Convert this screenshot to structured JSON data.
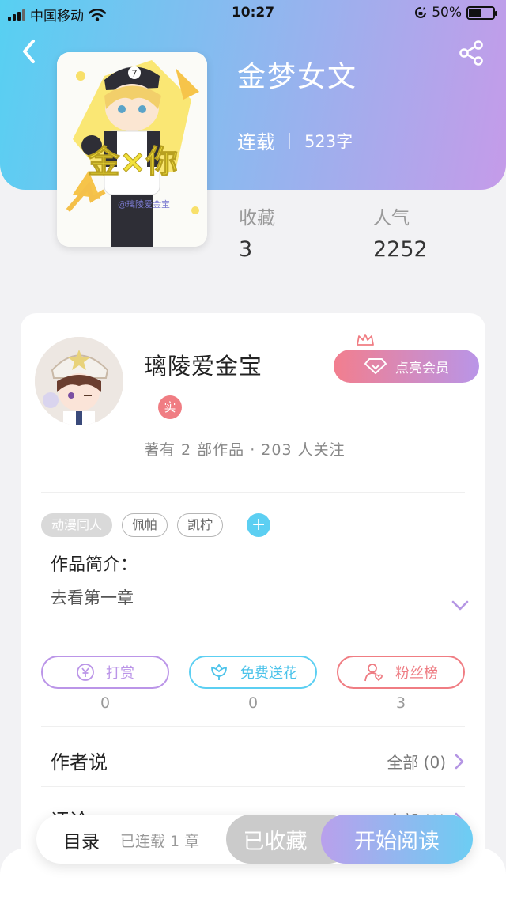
{
  "status_bar": {
    "carrier": "中国移动",
    "time": "10:27",
    "battery": "50%",
    "battery_level": 0.5
  },
  "colors": {
    "header_gradient": [
      "#57d0f2",
      "#8fb7ef",
      "#c59be9"
    ],
    "accent_blue": "#5ccff2",
    "accent_purple": "#b995e8",
    "accent_pink": "#f07d83"
  },
  "header": {
    "back_icon": "chevron-left-icon",
    "share_icon": "share-icon"
  },
  "book": {
    "title": "金梦女文",
    "status": "连载",
    "word_count": "523字",
    "cover_text": "金×你",
    "cover_watermark": "@璃陵爱金宝",
    "stats": [
      {
        "label": "收藏",
        "value": "3"
      },
      {
        "label": "人气",
        "value": "2252"
      }
    ]
  },
  "author": {
    "name": "璃陵爱金宝",
    "verified_badge": "实",
    "stats_text": "著有 2 部作品 · 203 人关注",
    "vip_button": "点亮会员"
  },
  "tags": [
    "动漫同人",
    "佩帕",
    "凯柠"
  ],
  "intro": {
    "label": "作品简介：",
    "text": "去看第一章"
  },
  "actions": [
    {
      "label": "打赏",
      "count": "0",
      "icon": "yen-coin-icon",
      "color": "#bb95e8"
    },
    {
      "label": "免费送花",
      "count": "0",
      "icon": "flower-icon",
      "color": "#5ccff2"
    },
    {
      "label": "粉丝榜",
      "count": "3",
      "icon": "fan-user-icon",
      "color": "#f07d83"
    }
  ],
  "sections": {
    "author_says": {
      "label": "作者说",
      "link": "全部 (0)"
    },
    "comments": {
      "label": "评论",
      "link": "全部 (0)"
    }
  },
  "bottom_bar": {
    "toc": "目录",
    "serial_info": "已连载 1 章",
    "collected": "已收藏",
    "read": "开始阅读"
  }
}
